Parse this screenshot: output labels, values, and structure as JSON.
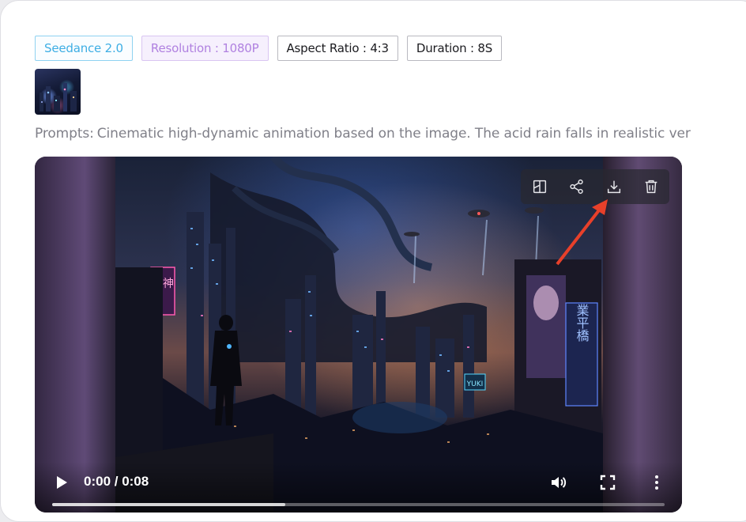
{
  "tags": {
    "model": "Seedance 2.0",
    "resolution": "Resolution : 1080P",
    "aspect_ratio": "Aspect Ratio : 4:3",
    "duration": "Duration : 8S"
  },
  "prompt": {
    "label": "Prompts:",
    "text": "Cinematic high-dynamic animation based on the image. The acid rain falls in realistic ver"
  },
  "video": {
    "time": "0:00 / 0:08",
    "progress": 0,
    "sign_left": "雷神",
    "sign_right": "業平橋",
    "sign_small": "YUKI"
  },
  "toolbar": {
    "icons": [
      "crop-frame-icon",
      "share-icon",
      "download-icon",
      "trash-icon"
    ]
  },
  "colors": {
    "model_tag": "#3eaee4",
    "resolution_tag": "#b081e0",
    "annotation_arrow": "#e8402a"
  }
}
